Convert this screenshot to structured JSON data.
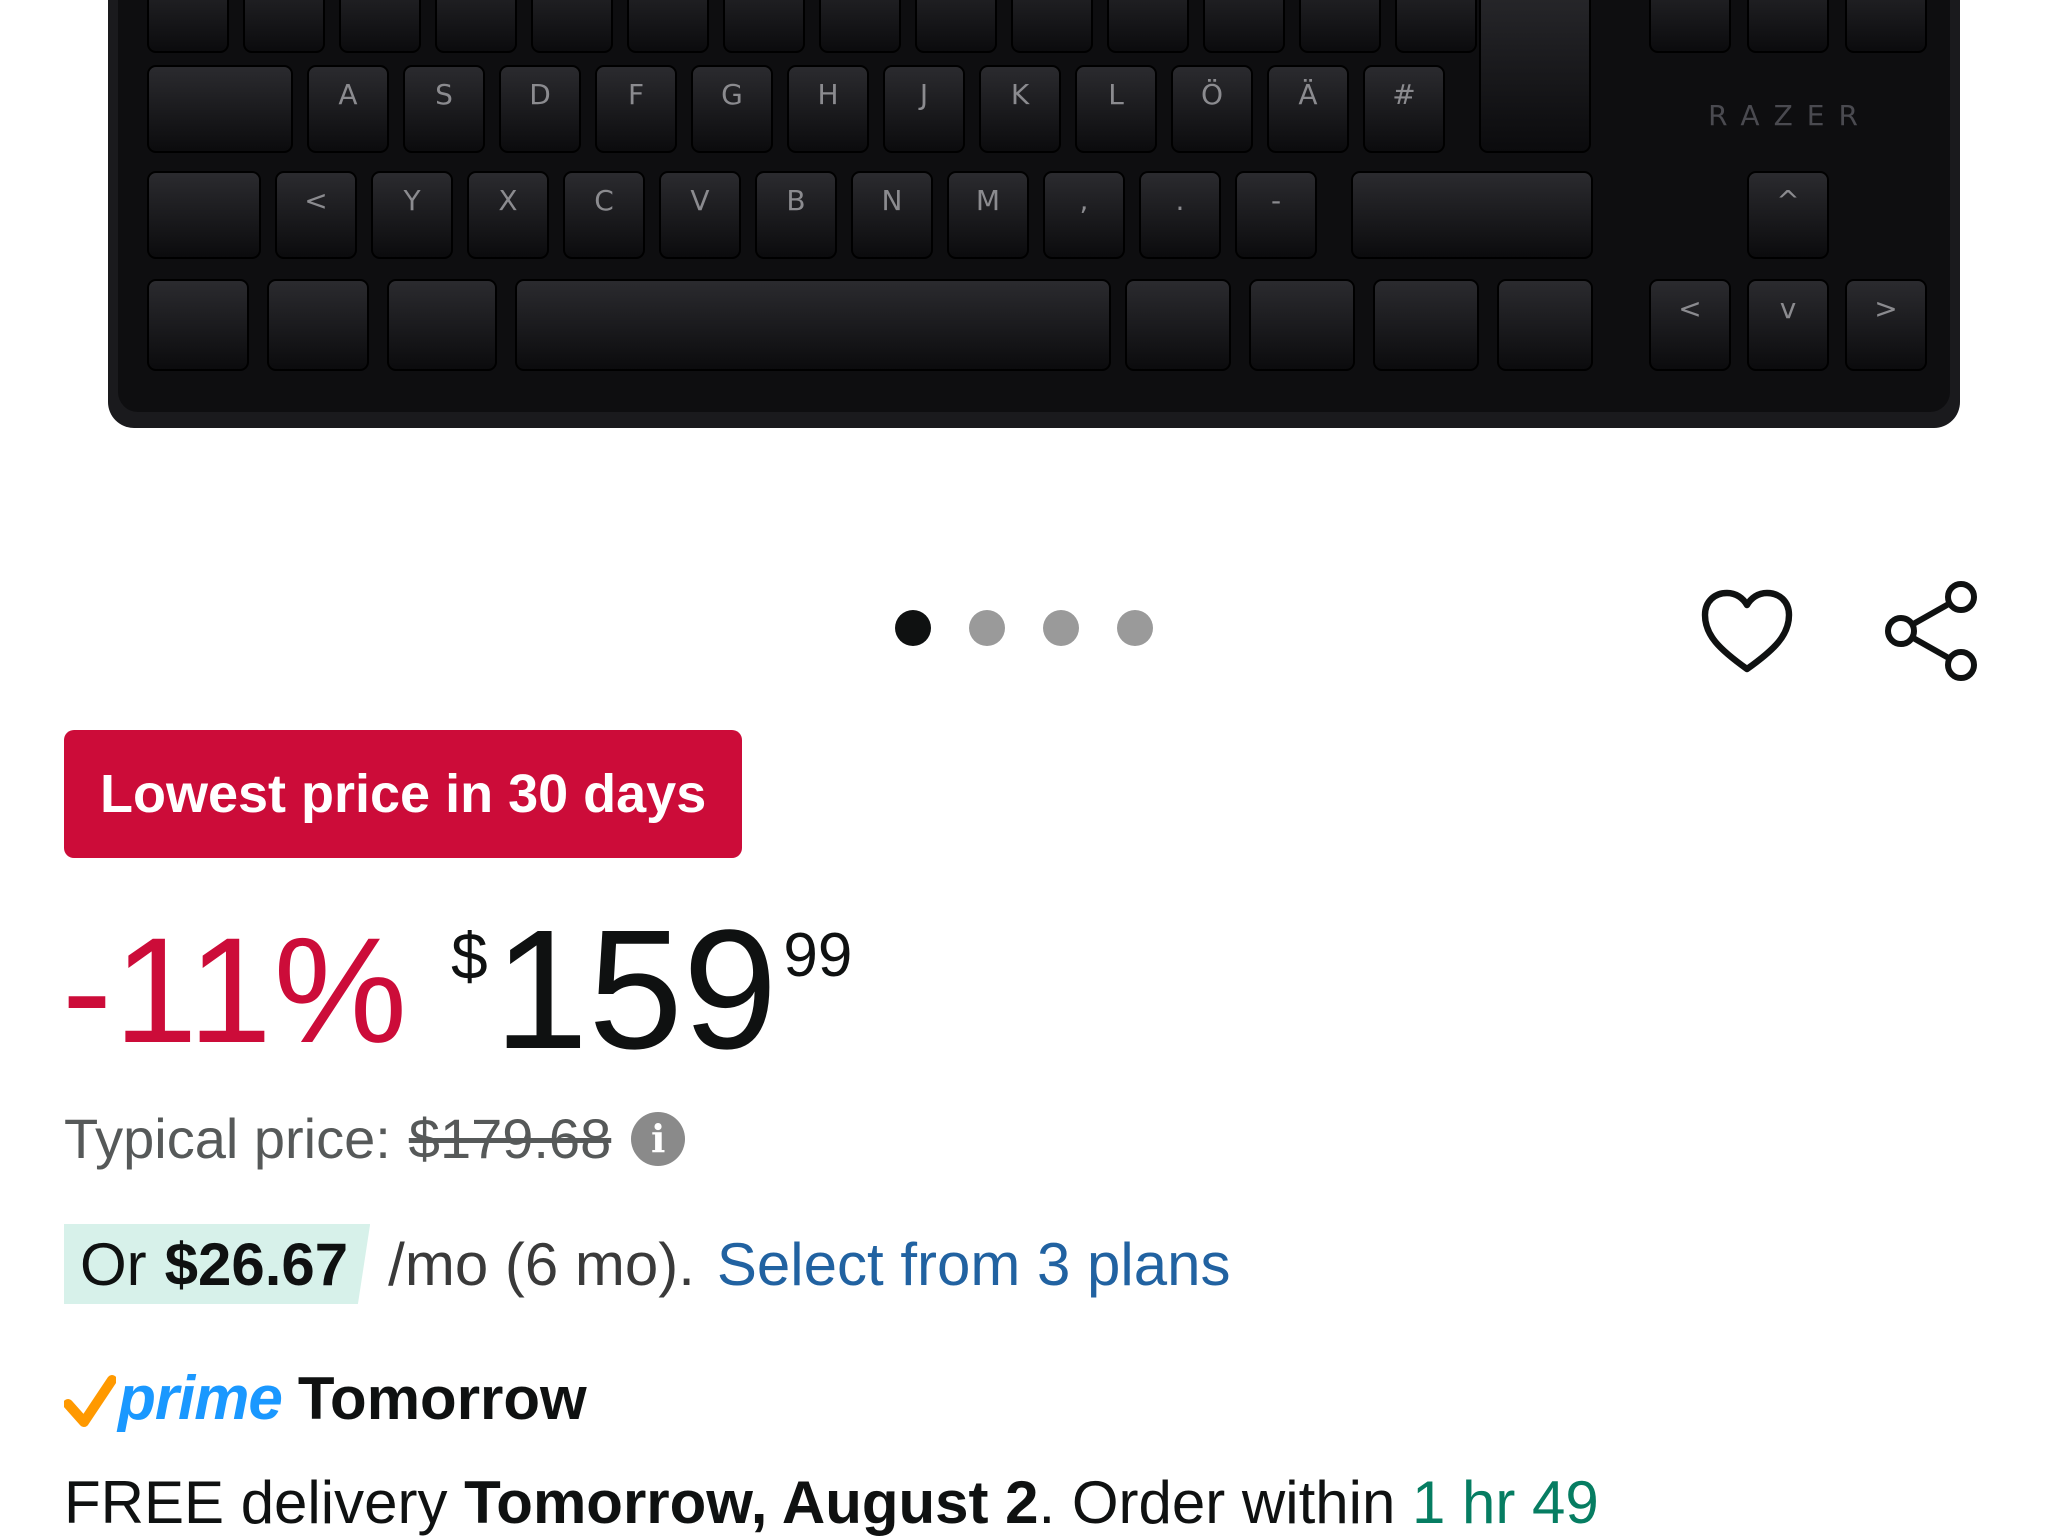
{
  "product_image": {
    "alt": "Razer keyboard",
    "brand_mark": "RAZER",
    "keys": {
      "row1": [
        "",
        "",
        "",
        "",
        "",
        "",
        "",
        "",
        "",
        "",
        "",
        "",
        "",
        ""
      ],
      "row2": [
        "",
        "A",
        "S",
        "D",
        "F",
        "G",
        "H",
        "J",
        "K",
        "L",
        "Ö",
        "Ä",
        "#"
      ],
      "row3": [
        "",
        "<",
        "Y",
        "X",
        "C",
        "V",
        "B",
        "N",
        "M",
        ",",
        ".",
        "-"
      ],
      "arrows": [
        "^",
        "<",
        "v",
        ">"
      ]
    }
  },
  "carousel": {
    "count": 4,
    "active_index": 0
  },
  "actions": {
    "wishlist_icon": "heart-icon",
    "share_icon": "share-icon"
  },
  "badge": {
    "label": "Lowest price in 30 days",
    "color": "#cc0c39"
  },
  "price": {
    "discount": "-11%",
    "currency": "$",
    "whole": "159",
    "fraction": "99"
  },
  "typical_price": {
    "label": "Typical price:",
    "value": "$179.68"
  },
  "installment": {
    "prefix": "Or",
    "amount": "$26.67",
    "term": "/mo (6 mo).",
    "link": "Select from 3 plans"
  },
  "prime": {
    "brand": "prime",
    "day": "Tomorrow"
  },
  "delivery": {
    "prefix": "FREE delivery",
    "date": "Tomorrow, August 2",
    "middle": ". Order within",
    "timer": "1 hr 49"
  }
}
